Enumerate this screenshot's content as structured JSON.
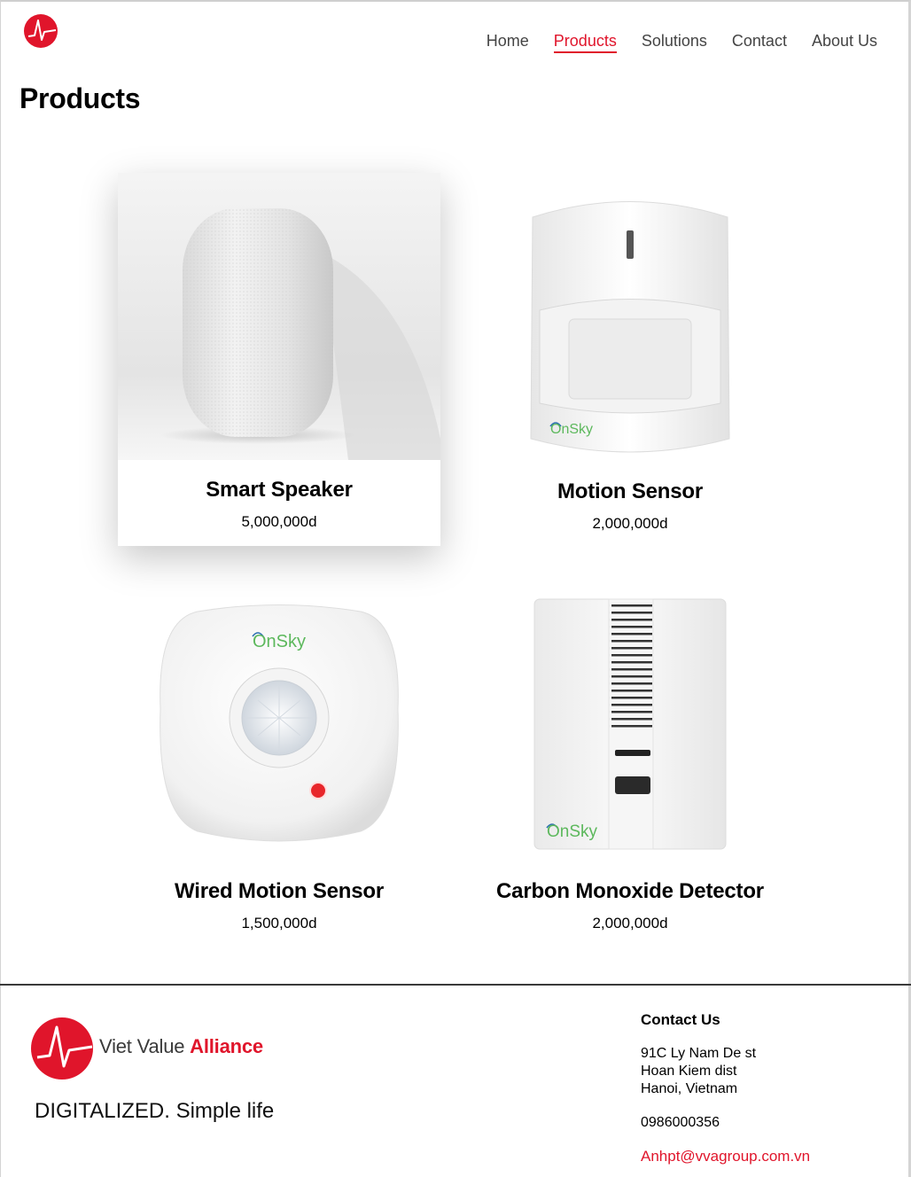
{
  "header": {
    "logo": "vva-logo-icon",
    "nav": [
      {
        "label": "Home"
      },
      {
        "label": "Products",
        "active": true
      },
      {
        "label": "Solutions"
      },
      {
        "label": "Contact"
      },
      {
        "label": "About Us"
      }
    ]
  },
  "page": {
    "title": "Products"
  },
  "products": [
    {
      "name": "Smart Speaker",
      "price": "5,000,000d",
      "image": "smart-speaker-image"
    },
    {
      "name": "Motion Sensor",
      "price": "2,000,000d",
      "image": "motion-sensor-image",
      "image_brand": "OnSky"
    },
    {
      "name": "Wired Motion Sensor",
      "price": "1,500,000d",
      "image": "wired-motion-sensor-image",
      "image_brand": "OnSky"
    },
    {
      "name": "Carbon Monoxide Detector",
      "price": "2,000,000d",
      "image": "co-detector-image",
      "image_brand": "OnSky"
    }
  ],
  "footer": {
    "brand_prefix": "Viet Value ",
    "brand_highlight": "Alliance",
    "slogan": "DIGITALIZED. Simple life",
    "contact": {
      "heading": "Contact Us",
      "address": [
        "91C Ly Nam De st",
        "Hoan Kiem dist",
        "Hanoi, Vietnam"
      ],
      "phone": "0986000356",
      "email": "Anhpt@vvagroup.com.vn"
    }
  },
  "colors": {
    "accent": "#e0152b",
    "nav_text": "#444444",
    "onsky_green": "#5cb85c",
    "onsky_blue": "#2a6fb0"
  }
}
